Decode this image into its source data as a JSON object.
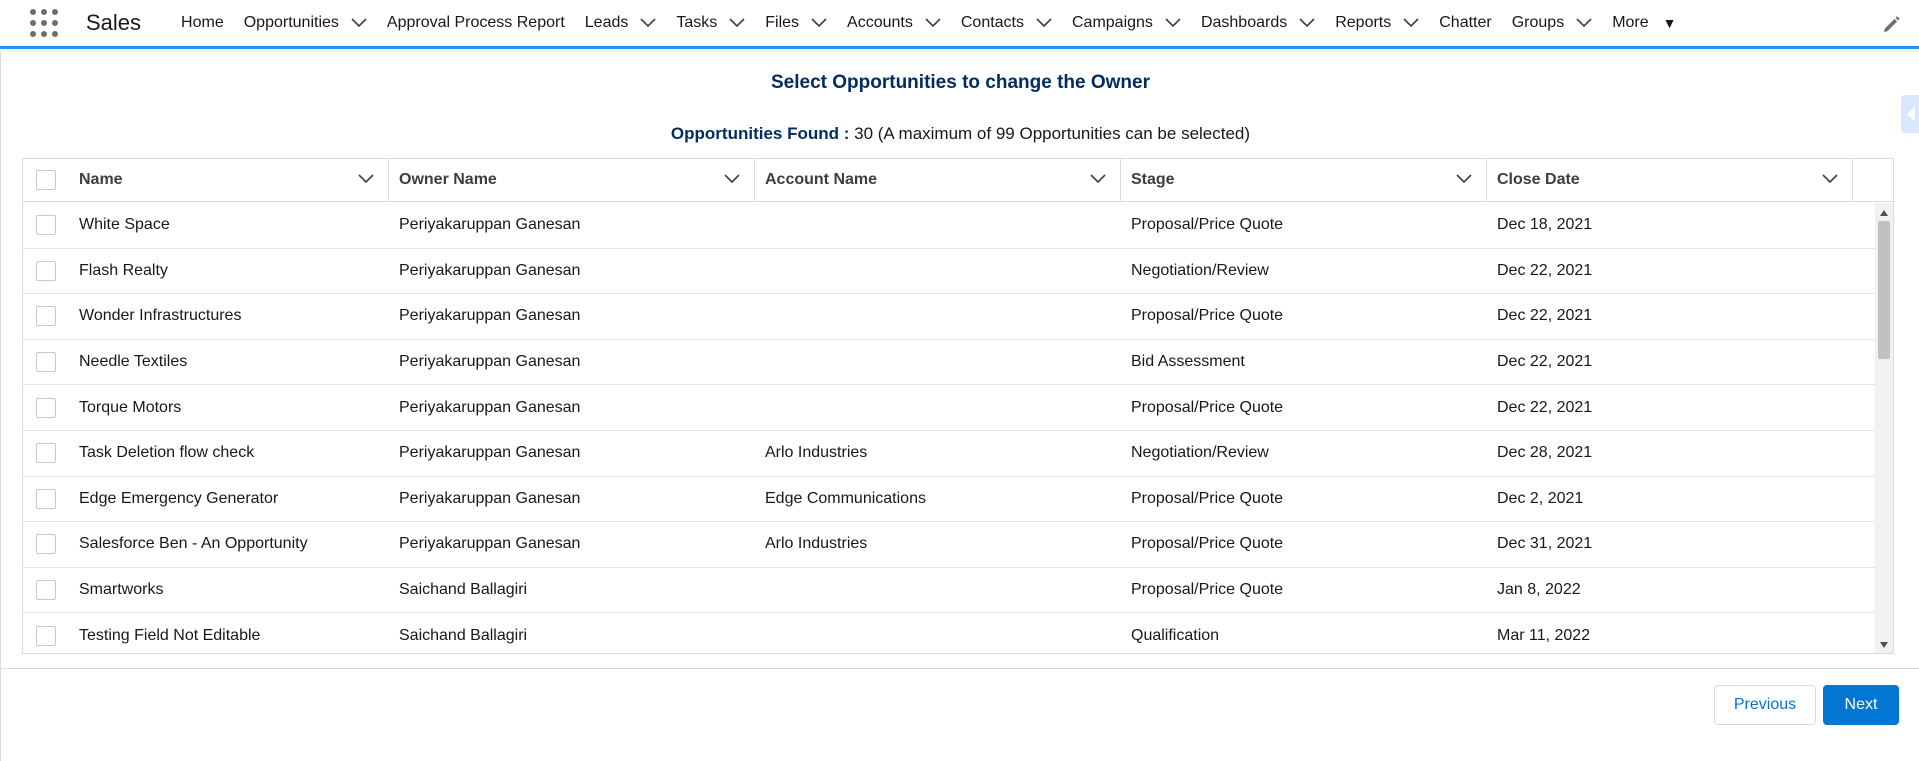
{
  "app": {
    "name": "Sales"
  },
  "nav": {
    "items": [
      {
        "label": "Home",
        "dropdown": false
      },
      {
        "label": "Opportunities",
        "dropdown": true
      },
      {
        "label": "Approval Process Report",
        "dropdown": false
      },
      {
        "label": "Leads",
        "dropdown": true
      },
      {
        "label": "Tasks",
        "dropdown": true
      },
      {
        "label": "Files",
        "dropdown": true
      },
      {
        "label": "Accounts",
        "dropdown": true
      },
      {
        "label": "Contacts",
        "dropdown": true
      },
      {
        "label": "Campaigns",
        "dropdown": true
      },
      {
        "label": "Dashboards",
        "dropdown": true
      },
      {
        "label": "Reports",
        "dropdown": true
      },
      {
        "label": "Chatter",
        "dropdown": false
      },
      {
        "label": "Groups",
        "dropdown": true
      },
      {
        "label": "More",
        "dropdown": false
      }
    ],
    "icons": {
      "launcher": "app-launcher-icon",
      "edit": "pencil-icon"
    }
  },
  "page": {
    "title": "Select Opportunities to change the Owner",
    "found_label": "Opportunities Found :",
    "found_value": "30 (A maximum of 99 Opportunities can be selected)"
  },
  "table": {
    "columns": [
      "Name",
      "Owner Name",
      "Account Name",
      "Stage",
      "Close Date"
    ],
    "rows": [
      {
        "name": "White Space",
        "owner": "Periyakaruppan Ganesan",
        "account": "",
        "stage": "Proposal/Price Quote",
        "close": "Dec 18, 2021"
      },
      {
        "name": "Flash Realty",
        "owner": "Periyakaruppan Ganesan",
        "account": "",
        "stage": "Negotiation/Review",
        "close": "Dec 22, 2021"
      },
      {
        "name": "Wonder Infrastructures",
        "owner": "Periyakaruppan Ganesan",
        "account": "",
        "stage": "Proposal/Price Quote",
        "close": "Dec 22, 2021"
      },
      {
        "name": "Needle Textiles",
        "owner": "Periyakaruppan Ganesan",
        "account": "",
        "stage": "Bid Assessment",
        "close": "Dec 22, 2021"
      },
      {
        "name": "Torque Motors",
        "owner": "Periyakaruppan Ganesan",
        "account": "",
        "stage": "Proposal/Price Quote",
        "close": "Dec 22, 2021"
      },
      {
        "name": "Task Deletion flow check",
        "owner": "Periyakaruppan Ganesan",
        "account": "Arlo Industries",
        "stage": "Negotiation/Review",
        "close": "Dec 28, 2021"
      },
      {
        "name": "Edge Emergency Generator",
        "owner": "Periyakaruppan Ganesan",
        "account": "Edge Communications",
        "stage": "Proposal/Price Quote",
        "close": "Dec 2, 2021"
      },
      {
        "name": "Salesforce Ben - An Opportunity",
        "owner": "Periyakaruppan Ganesan",
        "account": "Arlo Industries",
        "stage": "Proposal/Price Quote",
        "close": "Dec 31, 2021"
      },
      {
        "name": "Smartworks",
        "owner": "Saichand Ballagiri",
        "account": "",
        "stage": "Proposal/Price Quote",
        "close": "Jan 8, 2022"
      },
      {
        "name": "Testing Field Not Editable",
        "owner": "Saichand Ballagiri",
        "account": "",
        "stage": "Qualification",
        "close": "Mar 11, 2022"
      }
    ]
  },
  "footer": {
    "previous_label": "Previous",
    "next_label": "Next"
  },
  "colors": {
    "accent": "#1b96ff",
    "brand": "#0176d3",
    "title": "#032d60"
  }
}
